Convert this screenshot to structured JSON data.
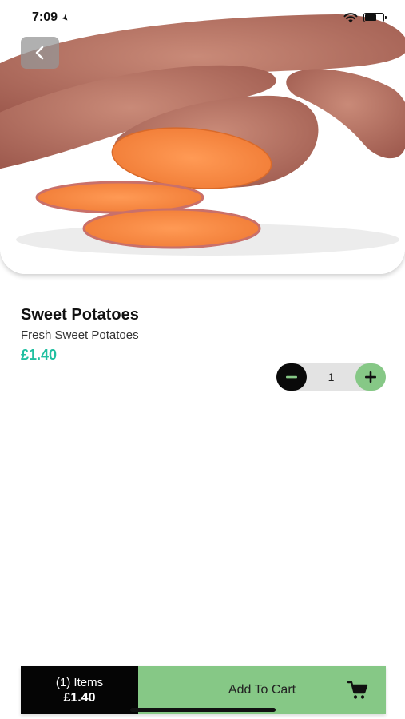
{
  "status_bar": {
    "time": "7:09",
    "location_icon": "location-arrow-icon",
    "wifi_icon": "wifi-icon",
    "battery_icon": "battery-icon"
  },
  "hero": {
    "image": "sweet-potatoes-photo",
    "back_icon": "chevron-left-icon"
  },
  "product": {
    "name": "Sweet Potatoes",
    "description": "Fresh Sweet Potatoes",
    "price": "£1.40",
    "price_color": "#1fbfa0"
  },
  "stepper": {
    "quantity": "1",
    "minus_icon": "minus-icon",
    "plus_icon": "plus-icon",
    "minus_color": "#0a0a0a",
    "plus_color": "#86c886"
  },
  "cart_bar": {
    "item_count": "(1) Items",
    "total": "£1.40",
    "button_label": "Add To Cart",
    "cart_icon": "shopping-cart-icon",
    "button_color": "#86c886"
  }
}
